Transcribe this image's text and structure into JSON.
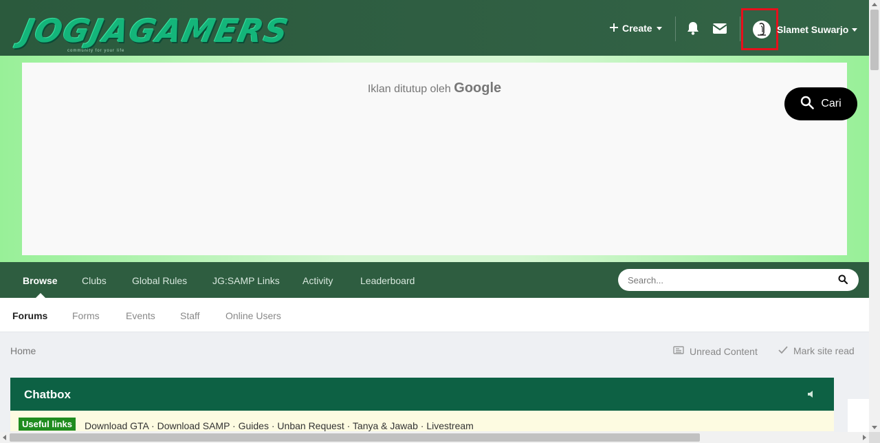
{
  "header": {
    "logo_text": "JOGJAGAMERS",
    "logo_tagline": "community for your life",
    "create_label": "Create",
    "username": "Slamet Suwarjo"
  },
  "ad": {
    "closed_text": "Iklan ditutup oleh",
    "closed_brand": "Google",
    "cari_label": "Cari"
  },
  "nav": {
    "items": [
      {
        "label": "Browse",
        "active": true
      },
      {
        "label": "Clubs"
      },
      {
        "label": "Global Rules"
      },
      {
        "label": "JG:SAMP Links"
      },
      {
        "label": "Activity"
      },
      {
        "label": "Leaderboard"
      }
    ],
    "search_placeholder": "Search..."
  },
  "subnav": {
    "items": [
      {
        "label": "Forums",
        "active": true
      },
      {
        "label": "Forms"
      },
      {
        "label": "Events"
      },
      {
        "label": "Staff"
      },
      {
        "label": "Online Users"
      }
    ]
  },
  "breadcrumb": {
    "home": "Home",
    "unread": "Unread Content",
    "mark_read": "Mark site read"
  },
  "chatbox": {
    "title": "Chatbox",
    "useful_label": "Useful links",
    "links": [
      "Download GTA",
      "Download SAMP",
      "Guides",
      "Unban Request",
      "Tanya & Jawab",
      "Livestream"
    ]
  },
  "colors": {
    "header_bg": "#2f5e42",
    "nav_bg": "#2e5d40",
    "chatbox_bg": "#0d6144",
    "highlight_box": "#e8101c",
    "useful_badge": "#1f8c1f"
  }
}
